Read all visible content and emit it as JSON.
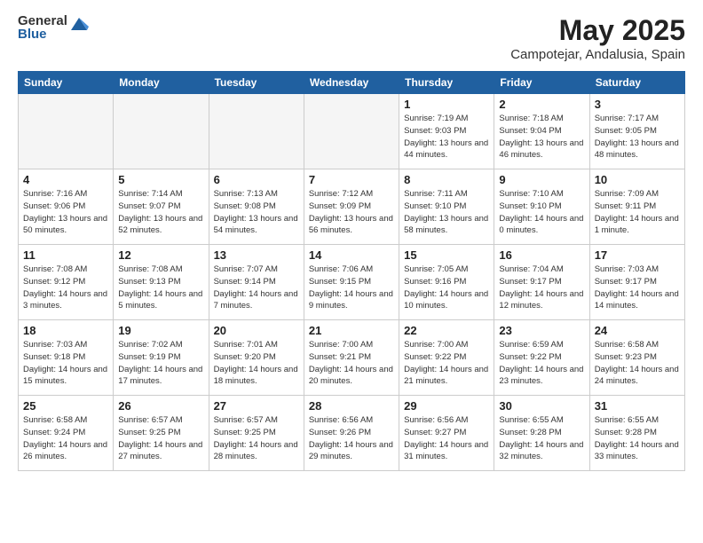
{
  "header": {
    "logo_general": "General",
    "logo_blue": "Blue",
    "month_year": "May 2025",
    "location": "Campotejar, Andalusia, Spain"
  },
  "days_of_week": [
    "Sunday",
    "Monday",
    "Tuesday",
    "Wednesday",
    "Thursday",
    "Friday",
    "Saturday"
  ],
  "weeks": [
    [
      {
        "day": "",
        "text": ""
      },
      {
        "day": "",
        "text": ""
      },
      {
        "day": "",
        "text": ""
      },
      {
        "day": "",
        "text": ""
      },
      {
        "day": "1",
        "text": "Sunrise: 7:19 AM\nSunset: 9:03 PM\nDaylight: 13 hours\nand 44 minutes."
      },
      {
        "day": "2",
        "text": "Sunrise: 7:18 AM\nSunset: 9:04 PM\nDaylight: 13 hours\nand 46 minutes."
      },
      {
        "day": "3",
        "text": "Sunrise: 7:17 AM\nSunset: 9:05 PM\nDaylight: 13 hours\nand 48 minutes."
      }
    ],
    [
      {
        "day": "4",
        "text": "Sunrise: 7:16 AM\nSunset: 9:06 PM\nDaylight: 13 hours\nand 50 minutes."
      },
      {
        "day": "5",
        "text": "Sunrise: 7:14 AM\nSunset: 9:07 PM\nDaylight: 13 hours\nand 52 minutes."
      },
      {
        "day": "6",
        "text": "Sunrise: 7:13 AM\nSunset: 9:08 PM\nDaylight: 13 hours\nand 54 minutes."
      },
      {
        "day": "7",
        "text": "Sunrise: 7:12 AM\nSunset: 9:09 PM\nDaylight: 13 hours\nand 56 minutes."
      },
      {
        "day": "8",
        "text": "Sunrise: 7:11 AM\nSunset: 9:10 PM\nDaylight: 13 hours\nand 58 minutes."
      },
      {
        "day": "9",
        "text": "Sunrise: 7:10 AM\nSunset: 9:10 PM\nDaylight: 14 hours\nand 0 minutes."
      },
      {
        "day": "10",
        "text": "Sunrise: 7:09 AM\nSunset: 9:11 PM\nDaylight: 14 hours\nand 1 minute."
      }
    ],
    [
      {
        "day": "11",
        "text": "Sunrise: 7:08 AM\nSunset: 9:12 PM\nDaylight: 14 hours\nand 3 minutes."
      },
      {
        "day": "12",
        "text": "Sunrise: 7:08 AM\nSunset: 9:13 PM\nDaylight: 14 hours\nand 5 minutes."
      },
      {
        "day": "13",
        "text": "Sunrise: 7:07 AM\nSunset: 9:14 PM\nDaylight: 14 hours\nand 7 minutes."
      },
      {
        "day": "14",
        "text": "Sunrise: 7:06 AM\nSunset: 9:15 PM\nDaylight: 14 hours\nand 9 minutes."
      },
      {
        "day": "15",
        "text": "Sunrise: 7:05 AM\nSunset: 9:16 PM\nDaylight: 14 hours\nand 10 minutes."
      },
      {
        "day": "16",
        "text": "Sunrise: 7:04 AM\nSunset: 9:17 PM\nDaylight: 14 hours\nand 12 minutes."
      },
      {
        "day": "17",
        "text": "Sunrise: 7:03 AM\nSunset: 9:17 PM\nDaylight: 14 hours\nand 14 minutes."
      }
    ],
    [
      {
        "day": "18",
        "text": "Sunrise: 7:03 AM\nSunset: 9:18 PM\nDaylight: 14 hours\nand 15 minutes."
      },
      {
        "day": "19",
        "text": "Sunrise: 7:02 AM\nSunset: 9:19 PM\nDaylight: 14 hours\nand 17 minutes."
      },
      {
        "day": "20",
        "text": "Sunrise: 7:01 AM\nSunset: 9:20 PM\nDaylight: 14 hours\nand 18 minutes."
      },
      {
        "day": "21",
        "text": "Sunrise: 7:00 AM\nSunset: 9:21 PM\nDaylight: 14 hours\nand 20 minutes."
      },
      {
        "day": "22",
        "text": "Sunrise: 7:00 AM\nSunset: 9:22 PM\nDaylight: 14 hours\nand 21 minutes."
      },
      {
        "day": "23",
        "text": "Sunrise: 6:59 AM\nSunset: 9:22 PM\nDaylight: 14 hours\nand 23 minutes."
      },
      {
        "day": "24",
        "text": "Sunrise: 6:58 AM\nSunset: 9:23 PM\nDaylight: 14 hours\nand 24 minutes."
      }
    ],
    [
      {
        "day": "25",
        "text": "Sunrise: 6:58 AM\nSunset: 9:24 PM\nDaylight: 14 hours\nand 26 minutes."
      },
      {
        "day": "26",
        "text": "Sunrise: 6:57 AM\nSunset: 9:25 PM\nDaylight: 14 hours\nand 27 minutes."
      },
      {
        "day": "27",
        "text": "Sunrise: 6:57 AM\nSunset: 9:25 PM\nDaylight: 14 hours\nand 28 minutes."
      },
      {
        "day": "28",
        "text": "Sunrise: 6:56 AM\nSunset: 9:26 PM\nDaylight: 14 hours\nand 29 minutes."
      },
      {
        "day": "29",
        "text": "Sunrise: 6:56 AM\nSunset: 9:27 PM\nDaylight: 14 hours\nand 31 minutes."
      },
      {
        "day": "30",
        "text": "Sunrise: 6:55 AM\nSunset: 9:28 PM\nDaylight: 14 hours\nand 32 minutes."
      },
      {
        "day": "31",
        "text": "Sunrise: 6:55 AM\nSunset: 9:28 PM\nDaylight: 14 hours\nand 33 minutes."
      }
    ]
  ]
}
